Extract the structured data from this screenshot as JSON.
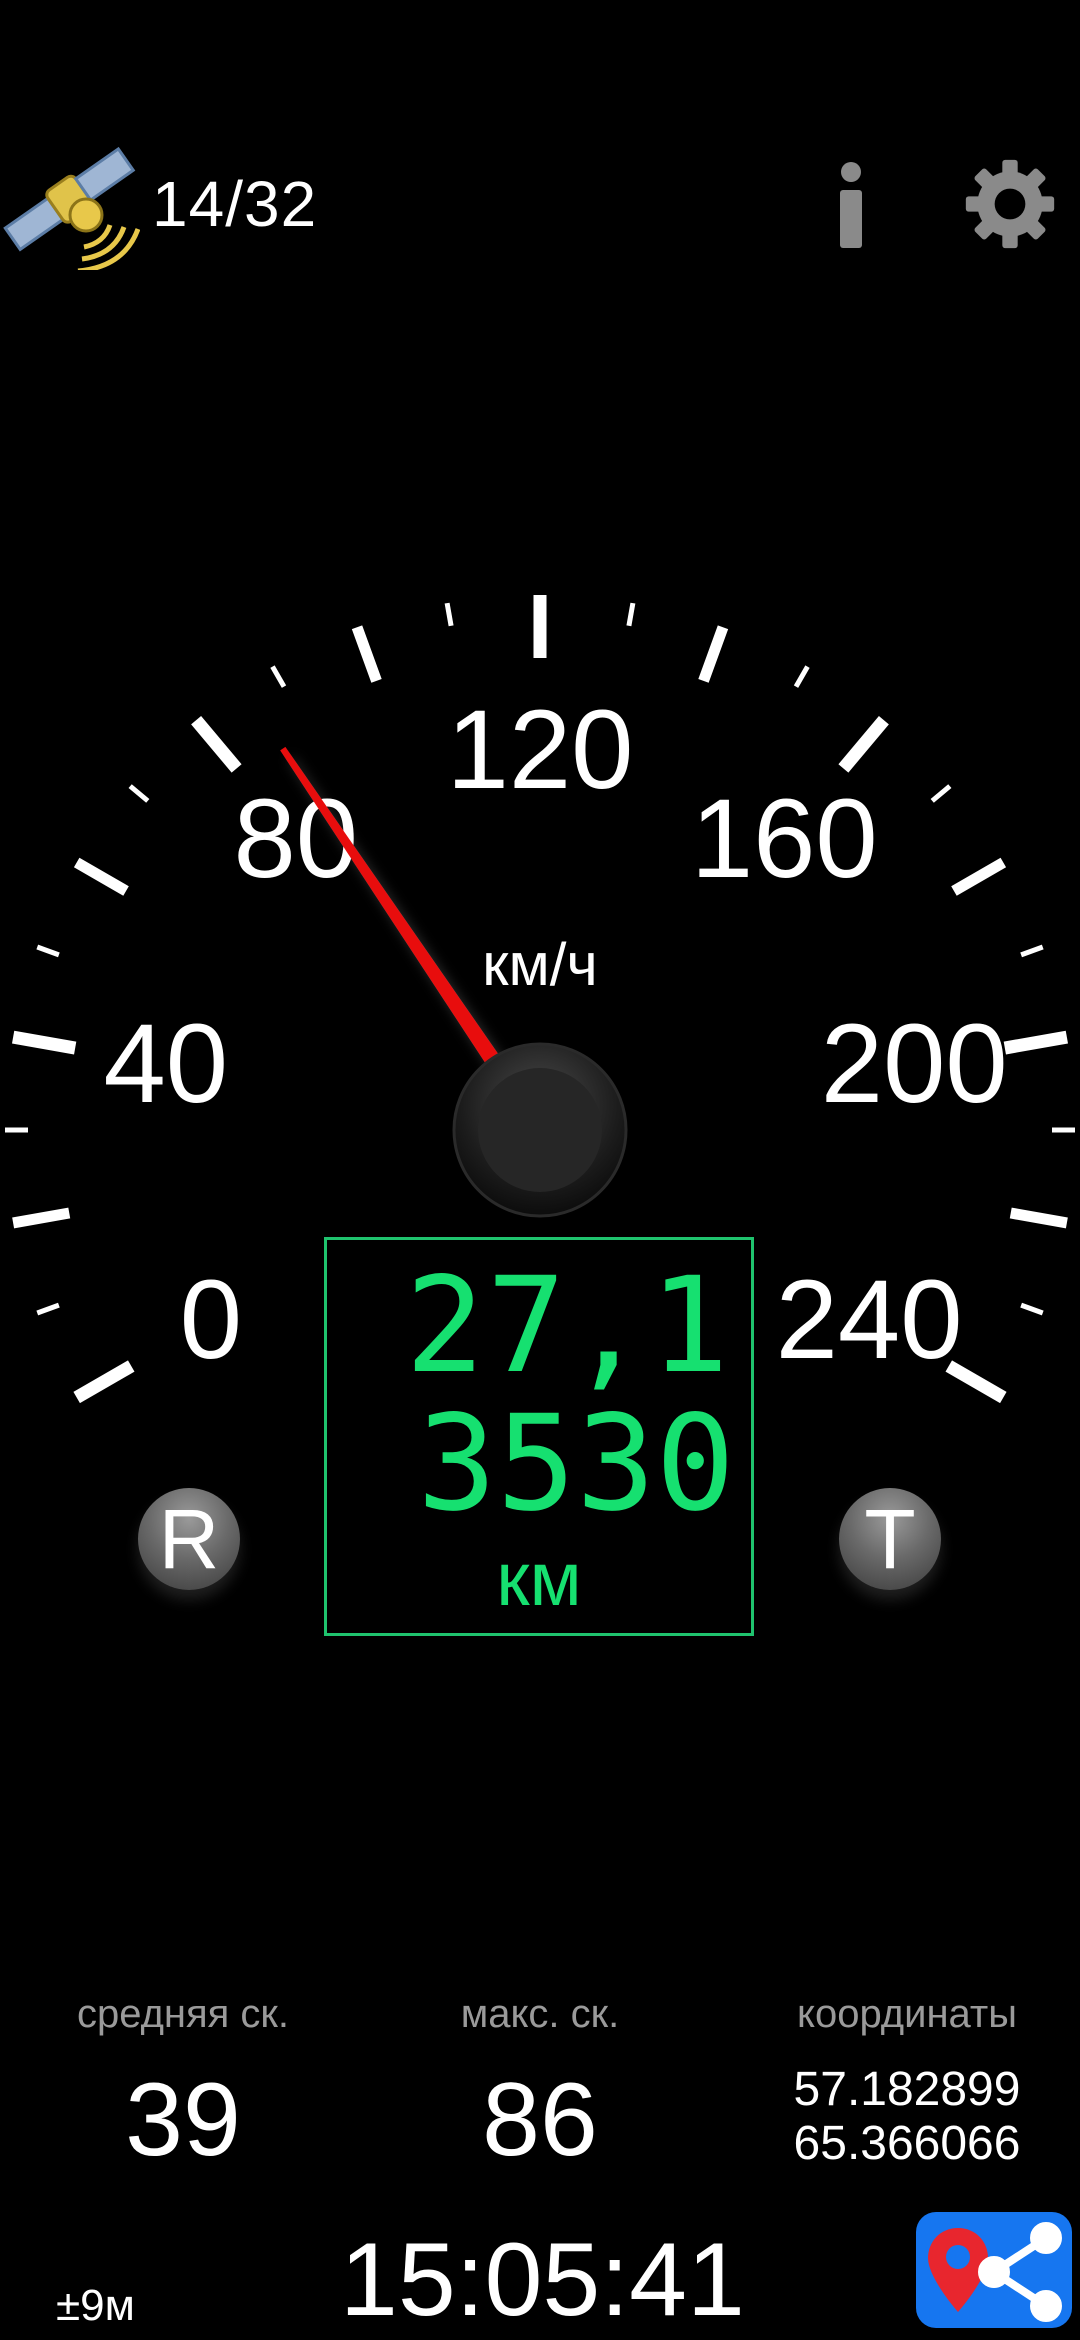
{
  "status": {
    "satellites": "14/32"
  },
  "gauge": {
    "unit": "км/ч",
    "scale_labels": [
      "0",
      "40",
      "80",
      "120",
      "160",
      "200",
      "240"
    ],
    "min": 0,
    "max": 240,
    "needle_value": 86,
    "needle_color": "#e81010"
  },
  "display": {
    "speed": "27,1",
    "odometer": "3530",
    "odometer_unit": "км",
    "digital_color": "#16e070"
  },
  "buttons": {
    "reset_label": "R",
    "trip_label": "T"
  },
  "stats": {
    "avg_label": "средняя ск.",
    "avg_value": "39",
    "max_label": "макс. ск.",
    "max_value": "86",
    "coords_label": "координаты",
    "lat": "57.182899",
    "lon": "65.366066"
  },
  "footer": {
    "accuracy": "±9м",
    "time": "15:05:41"
  },
  "colors": {
    "share_bg": "#1676f0",
    "icon_gray": "#8a8a8a"
  }
}
